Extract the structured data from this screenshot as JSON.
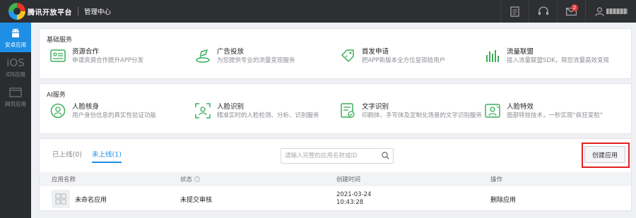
{
  "header": {
    "brand": "腾讯开放平台",
    "subtitle": "管理中心",
    "icons": [
      "document-icon",
      "headset-icon",
      "mail-icon",
      "user-icon"
    ],
    "mail_badge": "2"
  },
  "sidebar": {
    "items": [
      {
        "icon": "android-icon",
        "label": "安卓应用",
        "active": true
      },
      {
        "icon": "ios-icon",
        "glyph": "iOS",
        "label": "iOS应用",
        "active": false
      },
      {
        "icon": "web-icon",
        "label": "网页应用",
        "active": false
      }
    ]
  },
  "basic_services": {
    "title": "基础服务",
    "items": [
      {
        "icon": "resource-cooperation-icon",
        "name": "资源合作",
        "desc": "申请资源合作提升APP分发"
      },
      {
        "icon": "ad-delivery-icon",
        "name": "广告投放",
        "desc": "为您提供专业的流量变现服务"
      },
      {
        "icon": "first-launch-icon",
        "name": "首发申请",
        "desc": "把APP新版本全方位呈现给用户"
      },
      {
        "icon": "traffic-alliance-icon",
        "name": "流量联盟",
        "desc": "接入流量联盟SDK，帮您流量高效变现"
      }
    ]
  },
  "ai_services": {
    "title": "AI服务",
    "items": [
      {
        "icon": "face-verify-icon",
        "name": "人脸核身",
        "desc": "用户身份信息的真实性验证功能"
      },
      {
        "icon": "face-recognition-icon",
        "name": "人脸识别",
        "desc": "精准实时的人脸检测、分析、识别服务"
      },
      {
        "icon": "ocr-icon",
        "name": "文字识别",
        "desc": "印刷体、手写体及定制化场景的文字识别服务"
      },
      {
        "icon": "face-effects-icon",
        "name": "人脸特效",
        "desc": "面部特效技术，一秒实现“疯狂变脸”"
      }
    ]
  },
  "apps": {
    "tabs": [
      {
        "label": "已上线(0)",
        "active": false
      },
      {
        "label": "未上线(1)",
        "active": true
      }
    ],
    "search_placeholder": "请输入完整的应用名称或ID",
    "create_button": "创建应用",
    "columns": [
      "应用名称",
      "状态",
      "创建时间",
      "操作"
    ],
    "rows": [
      {
        "name": "未命名应用",
        "status": "未提交审核",
        "date": "2021-03-24",
        "time": "10:43:28",
        "action": "删除应用"
      }
    ]
  },
  "colors": {
    "accent": "#1f8fe5",
    "service_icon": "#3cae5a",
    "highlight": "#e02020",
    "topbar": "#2e2f33"
  }
}
